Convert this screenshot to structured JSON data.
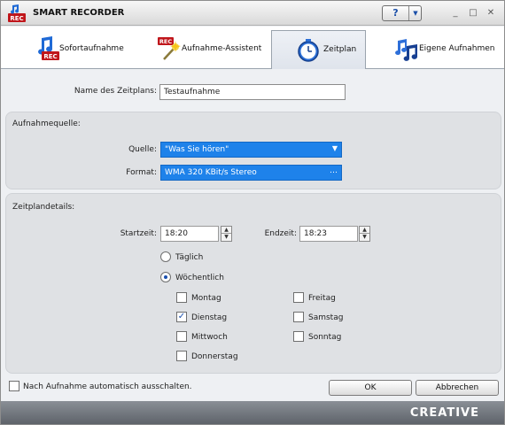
{
  "window": {
    "title": "SMART RECORDER",
    "help_label": "?",
    "controls": [
      "_",
      "□",
      "✕"
    ]
  },
  "tabs": [
    {
      "label": "Sofortaufnahme",
      "icon": "instant-record-icon"
    },
    {
      "label": "Aufnahme-Assistent",
      "icon": "wizard-icon"
    },
    {
      "label": "Zeitplan",
      "icon": "clock-icon",
      "active": true
    },
    {
      "label": "Eigene Aufnahmen",
      "icon": "music-notes-icon"
    }
  ],
  "schedule_name": {
    "label": "Name des Zeitplans:",
    "value": "Testaufnahme"
  },
  "source": {
    "title": "Aufnahmequelle:",
    "quelle_label": "Quelle:",
    "quelle_value": "\"Was Sie hören\"",
    "format_label": "Format:",
    "format_value": "WMA 320 KBit/s Stereo"
  },
  "details": {
    "title": "Zeitplandetails:",
    "start_label": "Startzeit:",
    "start_value": "18:20",
    "end_label": "Endzeit:",
    "end_value": "18:23",
    "daily_label": "Täglich",
    "weekly_label": "Wöchentlich",
    "days": {
      "montag": "Montag",
      "dienstag": "Dienstag",
      "mittwoch": "Mittwoch",
      "donnerstag": "Donnerstag",
      "freitag": "Freitag",
      "samstag": "Samstag",
      "sonntag": "Sonntag"
    }
  },
  "auto_shutdown_label": "Nach Aufnahme automatisch ausschalten.",
  "buttons": {
    "ok": "OK",
    "cancel": "Abbrechen"
  },
  "brand": "CREATIVE",
  "colors": {
    "accent": "#1e82ea",
    "panel": "#dfe1e4"
  }
}
